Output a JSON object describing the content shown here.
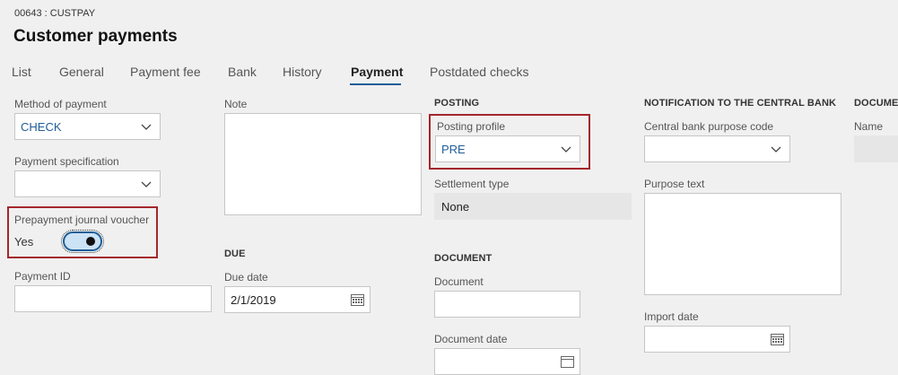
{
  "header": {
    "breadcrumb": "00643 : CUSTPAY",
    "title": "Customer payments"
  },
  "tabs": [
    {
      "label": "List"
    },
    {
      "label": "General"
    },
    {
      "label": "Payment fee"
    },
    {
      "label": "Bank"
    },
    {
      "label": "History"
    },
    {
      "label": "Payment",
      "active": true
    },
    {
      "label": "Postdated checks"
    }
  ],
  "payment": {
    "method_label": "Method of payment",
    "method_value": "CHECK",
    "spec_label": "Payment specification",
    "spec_value": "",
    "prepay_label": "Prepayment journal voucher",
    "prepay_value": "Yes",
    "prepay_on": true,
    "payment_id_label": "Payment ID",
    "payment_id_value": ""
  },
  "note": {
    "label": "Note",
    "value": ""
  },
  "due": {
    "section": "DUE",
    "due_date_label": "Due date",
    "due_date_value": "2/1/2019"
  },
  "posting": {
    "section": "POSTING",
    "profile_label": "Posting profile",
    "profile_value": "PRE",
    "settlement_label": "Settlement type",
    "settlement_value": "None"
  },
  "document": {
    "section": "DOCUMENT",
    "document_label": "Document",
    "document_value": "",
    "document_date_label": "Document date"
  },
  "central_bank": {
    "section": "NOTIFICATION TO THE CENTRAL BANK",
    "purpose_code_label": "Central bank purpose code",
    "purpose_code_value": "",
    "purpose_text_label": "Purpose text",
    "import_date_label": "Import date"
  },
  "doc_right": {
    "section": "DOCUMEN",
    "name_label": "Name"
  },
  "icons": {
    "dropdown": "chevron-down-icon",
    "date": "calendar-icon"
  },
  "colors": {
    "accent": "#1f5d99",
    "highlight": "#a4262c",
    "background": "#f0f0f0"
  }
}
